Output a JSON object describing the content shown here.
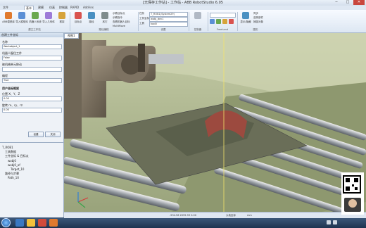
{
  "window": {
    "title": "工作站 - ABB RobotStudio 6.05",
    "title_prefix": "[无保存工作站]"
  },
  "menu_tabs": [
    "文件",
    "基本",
    "建模",
    "仿真",
    "控制器",
    "RAPID",
    "Add-Ins"
  ],
  "ribbon": {
    "buttons": [
      {
        "label": "ABB模型库",
        "icon": "robot-icon"
      },
      {
        "label": "导入模型库",
        "icon": "import-icon"
      },
      {
        "label": "机器人系统",
        "icon": "system-icon"
      },
      {
        "label": "导入几何体",
        "icon": "geometry-icon"
      },
      {
        "label": "框架",
        "icon": "frame-icon"
      },
      {
        "label": "目标点",
        "icon": "target-icon"
      },
      {
        "label": "路径",
        "icon": "path-icon"
      },
      {
        "label": "其它",
        "icon": "other-icon"
      }
    ],
    "groups": [
      "建立工作站",
      "路径编程",
      "设置",
      "控制器",
      "Freehand",
      "图形"
    ],
    "lines": [
      "示教目标点",
      "示教指令",
      "查看机器人目标",
      "MultiMove"
    ],
    "settings": {
      "task_label": "任务",
      "task_value": "T_ROB1(System29)",
      "workobject_label": "工件坐标",
      "workobject_value": "wobj_dec1",
      "tool_label": "工具",
      "tool_value": "tool0"
    },
    "right_buttons": [
      "显示/隐藏",
      "同步",
      "选择部件",
      "捕捉对象"
    ]
  },
  "left_panel": {
    "title": "创建工件坐标",
    "fields": [
      {
        "label": "名称",
        "value": "Workobject_1"
      },
      {
        "label": "机器人握住工件",
        "value": "False"
      },
      {
        "label": "被机械单元移动",
        "value": ""
      },
      {
        "label": "编程",
        "value": "True"
      }
    ],
    "frame_label": "用户坐标框架",
    "frame_fields": [
      {
        "label": "位置 X、Y、Z",
        "value": "0.00"
      },
      {
        "label": "旋转 rx、ry、rz",
        "value": "0.00"
      }
    ],
    "buttons": [
      "创建",
      "关闭"
    ],
    "tree_items": [
      "T_ROB1",
      "工具数据",
      "工件坐标 & 目标点",
      "wobj0",
      "wobj0_of",
      "Target_10",
      "路径与步骤",
      "Path_10"
    ]
  },
  "viewport": {
    "tab": "视图1"
  },
  "status": {
    "coords": "-534.56  2055.93  0.00",
    "frame": "大地坐标",
    "unit": "mm"
  }
}
